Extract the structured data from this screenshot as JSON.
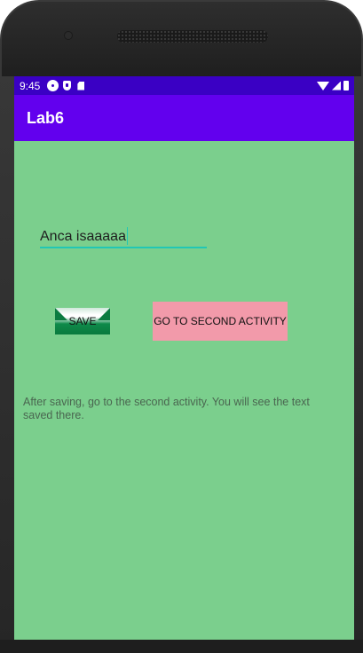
{
  "status_bar": {
    "time": "9:45",
    "icons_left": [
      "gear-icon",
      "shield-icon",
      "sdcard-icon"
    ],
    "icons_right": [
      "wifi-icon",
      "signal-icon",
      "battery-icon"
    ]
  },
  "app_bar": {
    "title": "Lab6"
  },
  "form": {
    "text_value": "Anca isaaaaa",
    "save_label": "SAVE",
    "second_activity_label": "GO TO SECOND ACTIVITY",
    "info_text": "After saving, go to the second activity. You will see the text saved there."
  },
  "colors": {
    "status_bar": "#3a00c4",
    "app_bar": "#6200ee",
    "screen_background": "#7bcf8d",
    "second_button": "#f29aaa",
    "field_underline": "#21c7b5"
  }
}
